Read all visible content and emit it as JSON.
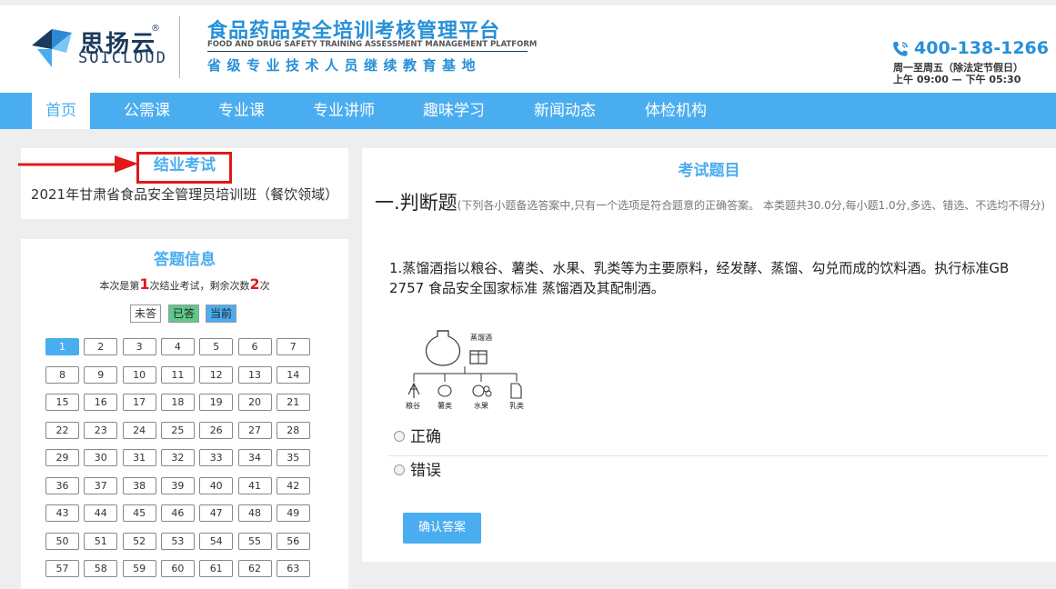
{
  "header": {
    "logo_cn": "思扬云",
    "logo_reg": "®",
    "logo_en": "SOICLOUD",
    "platform_title": "食品药品安全培训考核管理平台",
    "platform_en": "FOOD AND DRUG SAFETY TRAINING ASSESSMENT MANAGEMENT PLATFORM",
    "platform_sub": "省级专业技术人员继续教育基地",
    "phone": "400-138-1266",
    "hours_days": "周一至周五（除法定节假日）",
    "hours_time": "上午 09:00 — 下午 05:30"
  },
  "nav": {
    "items": [
      "首页",
      "公需课",
      "专业课",
      "专业讲师",
      "趣味学习",
      "新闻动态",
      "体检机构"
    ],
    "active_index": 0
  },
  "exam": {
    "title": "结业考试",
    "course": "2021年甘肃省食品安全管理员培训班（餐饮领域）"
  },
  "answer_info": {
    "title": "答题信息",
    "attempt_pre": "本次是第",
    "attempt_num": "1",
    "attempt_mid": "次结业考试，剩余次数",
    "remaining_num": "2",
    "attempt_post": "次",
    "legend_unanswered": "未答",
    "legend_answered": "已答",
    "legend_current": "当前",
    "questions": [
      "1",
      "2",
      "3",
      "4",
      "5",
      "6",
      "7",
      "8",
      "9",
      "10",
      "11",
      "12",
      "13",
      "14",
      "15",
      "16",
      "17",
      "18",
      "19",
      "20",
      "21",
      "22",
      "23",
      "24",
      "25",
      "26",
      "27",
      "28",
      "29",
      "30",
      "31",
      "32",
      "33",
      "34",
      "35",
      "36",
      "37",
      "38",
      "39",
      "40",
      "41",
      "42",
      "43",
      "44",
      "45",
      "46",
      "47",
      "48",
      "49",
      "50",
      "51",
      "52",
      "53",
      "54",
      "55",
      "56",
      "57",
      "58",
      "59",
      "60",
      "61",
      "62",
      "63"
    ],
    "current_question": 1
  },
  "question_panel": {
    "header": "考试题目",
    "section_title": "一.判断题",
    "section_note": "(下列各小题备选答案中,只有一个选项是符合题意的正确答案。 本类题共30.0分,每小题1.0分,多选、错选、不选均不得分)",
    "question_text": "1.蒸馏酒指以粮谷、薯类、水果、乳类等为主要原料，经发酵、蒸馏、勾兑而成的饮料酒。执行标准GB 2757 食品安全国家标准 蒸馏酒及其配制酒。",
    "diagram_labels": {
      "top": "蒸馏酒",
      "grain": "粮谷",
      "tuber": "薯类",
      "fruit": "水果",
      "dairy": "乳类"
    },
    "option_true": "正确",
    "option_false": "错误",
    "confirm_label": "确认答案"
  },
  "colors": {
    "accent": "#4aadf0",
    "highlight_red": "#e21818",
    "answered_green": "#5ec98a"
  }
}
